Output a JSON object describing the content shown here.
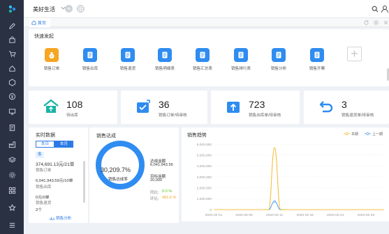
{
  "app": {
    "title": "美好生活"
  },
  "tabs": {
    "home": "首页"
  },
  "quick_launch": {
    "title": "快速发起",
    "items": [
      {
        "label": "销售订单",
        "color": "#f5a623"
      },
      {
        "label": "销售出库",
        "color": "#2f8cf0"
      },
      {
        "label": "销售退货",
        "color": "#2f8cf0"
      },
      {
        "label": "销售明细表",
        "color": "#2f8cf0"
      },
      {
        "label": "销售汇总表",
        "color": "#2f8cf0"
      },
      {
        "label": "销售排行表",
        "color": "#2f8cf0"
      },
      {
        "label": "销售分析",
        "color": "#2f8cf0"
      },
      {
        "label": "销售开票",
        "color": "#2f8cf0"
      }
    ]
  },
  "stats": [
    {
      "value": "108",
      "label": "待出库"
    },
    {
      "value": "36",
      "label": "销售订单/待审核"
    },
    {
      "value": "723",
      "label": "销售出库单/待审核"
    },
    {
      "value": "3",
      "label": "销售退货单/待审核"
    }
  ],
  "realtime": {
    "title": "实时数据",
    "tab_today": "本日",
    "tab_month": "本月",
    "badge": "客",
    "rows": [
      {
        "value": "374,691.13元/21单",
        "label": "销售订单"
      },
      {
        "value": "6,041,943.59元/10单",
        "label": "销售出库"
      },
      {
        "value": "0元/0单",
        "label": "销售退货"
      }
    ],
    "count": "2个",
    "link": "销售分析"
  },
  "achievement": {
    "title": "销售达成",
    "percent": "30,209.7%",
    "center_label": "销售达成率",
    "amount_label": "达成金额",
    "amount_value": "6,041,943.59",
    "target_label": "目标金额",
    "target_value": "20,000",
    "yoy_label": "同比:",
    "yoy_value": "0.0 %",
    "mom_label": "环比:",
    "mom_value": "481.6 %",
    "colors": {
      "ring": "#2f8cf0",
      "yoy": "#52c41a",
      "mom": "#f5a623"
    }
  },
  "trend": {
    "title": "销售趋势",
    "legend_current": "本期",
    "legend_prev": "上一期"
  },
  "chart_data": {
    "type": "line",
    "title": "销售趋势",
    "x_ticks": [
      "2020-02-01",
      "2020-02-06",
      "2020-02-11",
      "2020-02-16",
      "2020-02-21",
      "2020-02-26"
    ],
    "y_ticks": [
      "0",
      "1,000,000",
      "2,000,000",
      "3,000,000",
      "4,000,000",
      "5,000,000",
      "6,000,000"
    ],
    "ylim": [
      0,
      6000000
    ],
    "grid": true,
    "legend_position": "top-right",
    "x": [
      "2020-02-01",
      "2020-02-02",
      "2020-02-03",
      "2020-02-04",
      "2020-02-05",
      "2020-02-06",
      "2020-02-07",
      "2020-02-08",
      "2020-02-09",
      "2020-02-10",
      "2020-02-11",
      "2020-02-12",
      "2020-02-13",
      "2020-02-14",
      "2020-02-15",
      "2020-02-16",
      "2020-02-17",
      "2020-02-18",
      "2020-02-19",
      "2020-02-20",
      "2020-02-21",
      "2020-02-22",
      "2020-02-23",
      "2020-02-24",
      "2020-02-25",
      "2020-02-26",
      "2020-02-27",
      "2020-02-28",
      "2020-02-29"
    ],
    "series": [
      {
        "name": "本期",
        "color": "#f5c142",
        "values": [
          0,
          0,
          0,
          0,
          0,
          0,
          0,
          0,
          0,
          5000,
          5600000,
          20000,
          0,
          0,
          0,
          0,
          0,
          0,
          0,
          0,
          0,
          0,
          0,
          0,
          0,
          0,
          0,
          0,
          0
        ]
      },
      {
        "name": "上一期",
        "color": "#5aa9f0",
        "values": [
          0,
          0,
          0,
          0,
          0,
          0,
          0,
          0,
          0,
          0,
          750000,
          0,
          0,
          0,
          0,
          0,
          0,
          0,
          0,
          0,
          0,
          0,
          0,
          0,
          0,
          0,
          0,
          0,
          0
        ]
      }
    ]
  }
}
